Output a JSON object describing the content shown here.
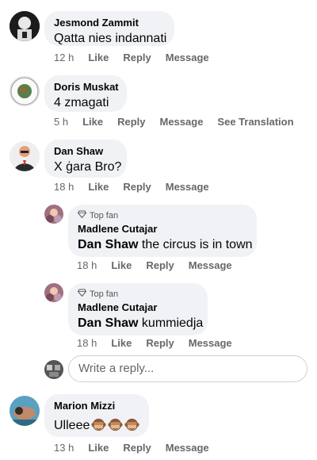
{
  "comments": [
    {
      "author": "Jesmond Zammit",
      "text": "Qatta nies indannati",
      "time": "12 h",
      "actions": [
        "Like",
        "Reply",
        "Message"
      ]
    },
    {
      "author": "Doris Muskat",
      "text": "4 zmagati",
      "time": "5 h",
      "actions": [
        "Like",
        "Reply",
        "Message",
        "See Translation"
      ]
    },
    {
      "author": "Dan Shaw",
      "text": "X ġara Bro?",
      "time": "18 h",
      "actions": [
        "Like",
        "Reply",
        "Message"
      ],
      "replies": [
        {
          "badge": "Top fan",
          "author": "Madlene Cutajar",
          "mention": "Dan Shaw",
          "text": " the circus is in town",
          "time": "18 h",
          "actions": [
            "Like",
            "Reply",
            "Message"
          ]
        },
        {
          "badge": "Top fan",
          "author": "Madlene Cutajar",
          "mention": "Dan Shaw",
          "text": " kummiedja",
          "time": "18 h",
          "actions": [
            "Like",
            "Reply",
            "Message"
          ]
        }
      ],
      "reply_placeholder": "Write a reply..."
    },
    {
      "author": "Marion Mizzi",
      "text": "Ulleee",
      "time": "13 h",
      "actions": [
        "Like",
        "Reply",
        "Message"
      ],
      "emoji_count": 3
    }
  ]
}
